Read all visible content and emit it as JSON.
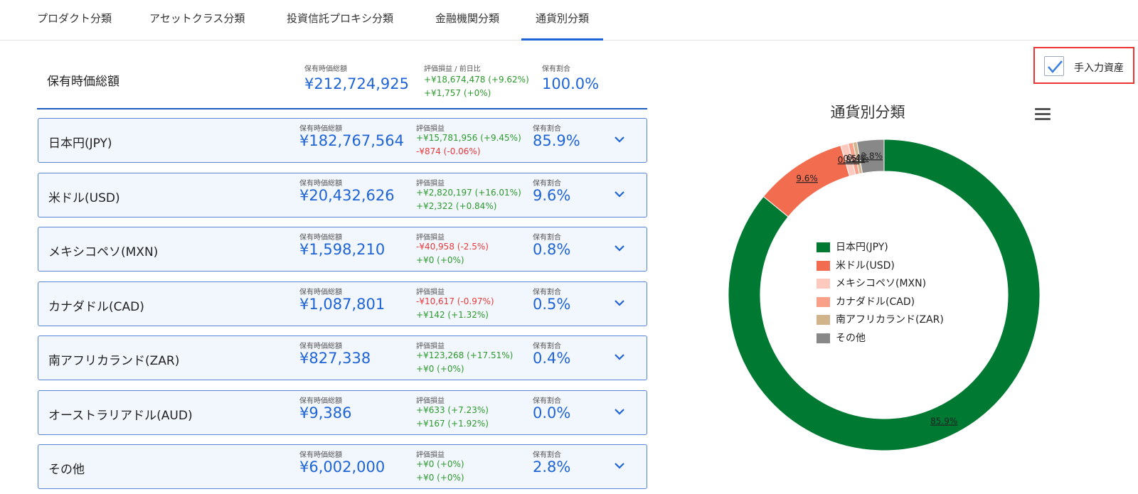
{
  "tabs": [
    {
      "label": "プロダクト分類",
      "active": false
    },
    {
      "label": "アセットクラス分類",
      "active": false
    },
    {
      "label": "投資信託プロキシ分類",
      "active": false
    },
    {
      "label": "金融機関分類",
      "active": false
    },
    {
      "label": "通貨別分類",
      "active": true
    }
  ],
  "total": {
    "name": "保有時価総額",
    "value_label": "保有時価総額",
    "value": "¥212,724,925",
    "pl_label": "評価損益 / 前日比",
    "pl": "+¥18,674,478 (+9.62%)",
    "daily": "+¥1,757 (+0%)",
    "share_label": "保有割合",
    "share": "100.0%"
  },
  "rows": [
    {
      "name": "日本円(JPY)",
      "value_label": "保有時価総額",
      "value": "¥182,767,564",
      "pl_label": "評価損益",
      "pl": "+¥15,781,956 (+9.45%)",
      "pl_sign": "pos",
      "daily": "-¥874 (-0.06%)",
      "daily_sign": "neg",
      "share_label": "保有割合",
      "share": "85.9%"
    },
    {
      "name": "米ドル(USD)",
      "value_label": "保有時価総額",
      "value": "¥20,432,626",
      "pl_label": "評価損益",
      "pl": "+¥2,820,197 (+16.01%)",
      "pl_sign": "pos",
      "daily": "+¥2,322 (+0.84%)",
      "daily_sign": "pos",
      "share_label": "保有割合",
      "share": "9.6%"
    },
    {
      "name": "メキシコペソ(MXN)",
      "value_label": "保有時価総額",
      "value": "¥1,598,210",
      "pl_label": "評価損益",
      "pl": "-¥40,958 (-2.5%)",
      "pl_sign": "neg",
      "daily": "+¥0 (+0%)",
      "daily_sign": "pos",
      "share_label": "保有割合",
      "share": "0.8%"
    },
    {
      "name": "カナダドル(CAD)",
      "value_label": "保有時価総額",
      "value": "¥1,087,801",
      "pl_label": "評価損益",
      "pl": "-¥10,617 (-0.97%)",
      "pl_sign": "neg",
      "daily": "+¥142 (+1.32%)",
      "daily_sign": "pos",
      "share_label": "保有割合",
      "share": "0.5%"
    },
    {
      "name": "南アフリカランド(ZAR)",
      "value_label": "保有時価総額",
      "value": "¥827,338",
      "pl_label": "評価損益",
      "pl": "+¥123,268 (+17.51%)",
      "pl_sign": "pos",
      "daily": "+¥0 (+0%)",
      "daily_sign": "pos",
      "share_label": "保有割合",
      "share": "0.4%"
    },
    {
      "name": "オーストラリアドル(AUD)",
      "value_label": "保有時価総額",
      "value": "¥9,386",
      "pl_label": "評価損益",
      "pl": "+¥633 (+7.23%)",
      "pl_sign": "pos",
      "daily": "+¥167 (+1.92%)",
      "daily_sign": "pos",
      "share_label": "保有割合",
      "share": "0.0%"
    },
    {
      "name": "その他",
      "value_label": "保有時価総額",
      "value": "¥6,002,000",
      "pl_label": "評価損益",
      "pl": "+¥0 (+0%)",
      "pl_sign": "pos",
      "daily": "+¥0 (+0%)",
      "daily_sign": "pos",
      "share_label": "保有割合",
      "share": "2.8%"
    }
  ],
  "manual_asset": {
    "label": "手入力資産",
    "checked": true
  },
  "icons": {
    "expand": "chevron-down-icon",
    "menu": "hamburger-menu-icon",
    "check": "check-icon"
  },
  "colors": {
    "accent": "#1e64d6",
    "positive": "#2c9a2c",
    "negative": "#e83a3a",
    "highlight_border": "#ee3333"
  },
  "chart_data": {
    "type": "pie",
    "title": "通貨別分類",
    "legend_position": "center",
    "slices": [
      {
        "name": "日本円(JPY)",
        "value": 85.9,
        "label": "85.9%",
        "color": "#007a33"
      },
      {
        "name": "米ドル(USD)",
        "value": 9.6,
        "label": "9.6%",
        "color": "#f26c4f"
      },
      {
        "name": "メキシコペソ(MXN)",
        "value": 0.8,
        "label": "0.8%",
        "color": "#fbc9bd"
      },
      {
        "name": "カナダドル(CAD)",
        "value": 0.5,
        "label": "0.5%",
        "color": "#f9a08a"
      },
      {
        "name": "南アフリカランド(ZAR)",
        "value": 0.4,
        "label": "0.4%",
        "color": "#d2b48c"
      },
      {
        "name": "その他",
        "value": 2.8,
        "label": "2.8%",
        "color": "#888888"
      }
    ]
  }
}
